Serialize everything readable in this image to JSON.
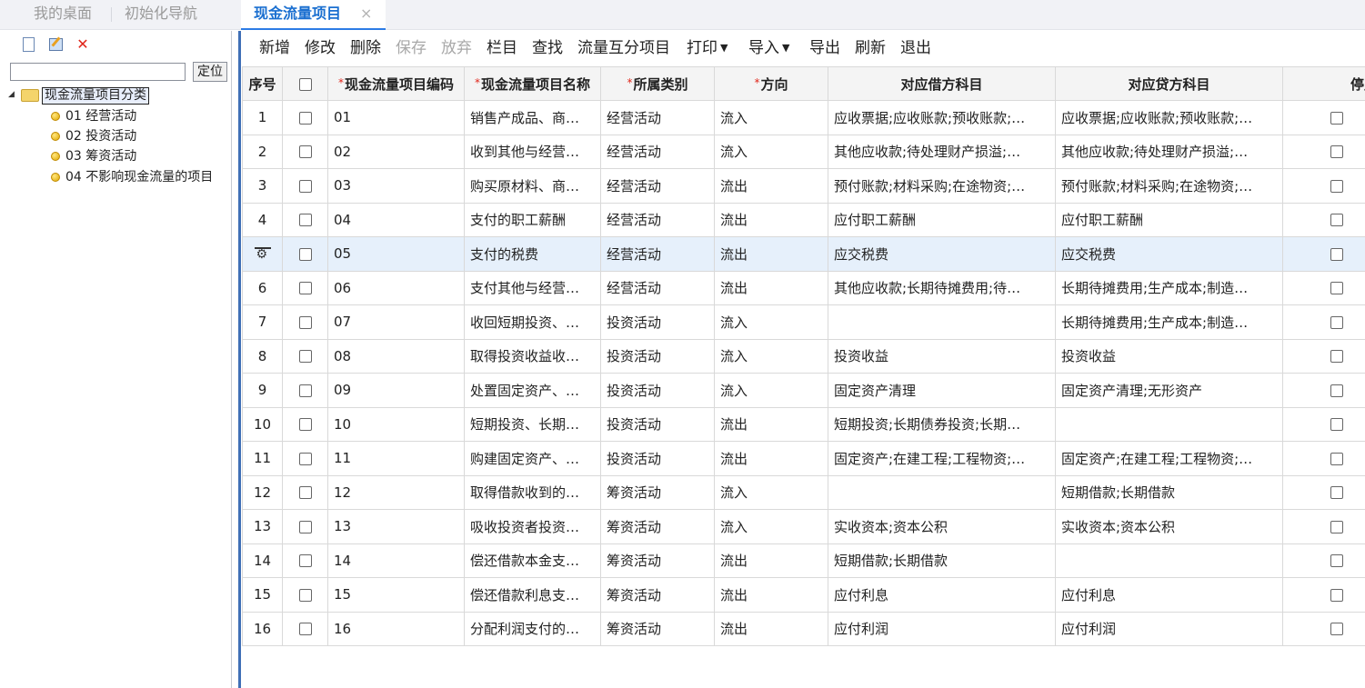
{
  "tabs": {
    "desktop": "我的桌面",
    "init_nav": "初始化导航",
    "active": "现金流量项目",
    "close": "×"
  },
  "left_panel": {
    "locate_button": "定位",
    "search_value": "",
    "tree": {
      "root": "现金流量项目分类",
      "children": [
        "01 经营活动",
        "02 投资活动",
        "03 筹资活动",
        "04 不影响现金流量的项目"
      ]
    }
  },
  "toolbar": {
    "add": "新增",
    "modify": "修改",
    "delete": "删除",
    "save": "保存",
    "discard": "放弃",
    "columns": "栏目",
    "find": "查找",
    "mutual": "流量互分项目",
    "print": "打印",
    "import": "导入",
    "export": "导出",
    "refresh": "刷新",
    "exit": "退出"
  },
  "grid": {
    "headers": {
      "seq": "序号",
      "code": "现金流量项目编码",
      "name": "现金流量项目名称",
      "category": "所属类别",
      "direction": "方向",
      "debit": "对应借方科目",
      "credit": "对应贷方科目",
      "disabled": "停用"
    },
    "rows": [
      {
        "seq": "1",
        "code": "01",
        "name": "销售产成品、商…",
        "category": "经营活动",
        "direction": "流入",
        "debit": "应收票据;应收账款;预收账款;…",
        "credit": "应收票据;应收账款;预收账款;…"
      },
      {
        "seq": "2",
        "code": "02",
        "name": "收到其他与经营…",
        "category": "经营活动",
        "direction": "流入",
        "debit": "其他应收款;待处理财产损溢;…",
        "credit": "其他应收款;待处理财产损溢;…"
      },
      {
        "seq": "3",
        "code": "03",
        "name": "购买原材料、商…",
        "category": "经营活动",
        "direction": "流出",
        "debit": "预付账款;材料采购;在途物资;…",
        "credit": "预付账款;材料采购;在途物资;…"
      },
      {
        "seq": "4",
        "code": "04",
        "name": "支付的职工薪酬",
        "category": "经营活动",
        "direction": "流出",
        "debit": "应付职工薪酬",
        "credit": "应付职工薪酬"
      },
      {
        "seq": "",
        "code": "05",
        "name": "支付的税费",
        "category": "经营活动",
        "direction": "流出",
        "debit": "应交税费",
        "credit": "应交税费"
      },
      {
        "seq": "6",
        "code": "06",
        "name": "支付其他与经营…",
        "category": "经营活动",
        "direction": "流出",
        "debit": "其他应收款;长期待摊费用;待…",
        "credit": "长期待摊费用;生产成本;制造…"
      },
      {
        "seq": "7",
        "code": "07",
        "name": "收回短期投资、…",
        "category": "投资活动",
        "direction": "流入",
        "debit": "",
        "credit": "长期待摊费用;生产成本;制造…"
      },
      {
        "seq": "8",
        "code": "08",
        "name": "取得投资收益收…",
        "category": "投资活动",
        "direction": "流入",
        "debit": "投资收益",
        "credit": "投资收益"
      },
      {
        "seq": "9",
        "code": "09",
        "name": "处置固定资产、…",
        "category": "投资活动",
        "direction": "流入",
        "debit": "固定资产清理",
        "credit": "固定资产清理;无形资产"
      },
      {
        "seq": "10",
        "code": "10",
        "name": "短期投资、长期…",
        "category": "投资活动",
        "direction": "流出",
        "debit": "短期投资;长期债券投资;长期…",
        "credit": ""
      },
      {
        "seq": "11",
        "code": "11",
        "name": "购建固定资产、…",
        "category": "投资活动",
        "direction": "流出",
        "debit": "固定资产;在建工程;工程物资;…",
        "credit": "固定资产;在建工程;工程物资;…"
      },
      {
        "seq": "12",
        "code": "12",
        "name": "取得借款收到的…",
        "category": "筹资活动",
        "direction": "流入",
        "debit": "",
        "credit": "短期借款;长期借款"
      },
      {
        "seq": "13",
        "code": "13",
        "name": "吸收投资者投资…",
        "category": "筹资活动",
        "direction": "流入",
        "debit": "实收资本;资本公积",
        "credit": "实收资本;资本公积"
      },
      {
        "seq": "14",
        "code": "14",
        "name": "偿还借款本金支…",
        "category": "筹资活动",
        "direction": "流出",
        "debit": "短期借款;长期借款",
        "credit": ""
      },
      {
        "seq": "15",
        "code": "15",
        "name": "偿还借款利息支…",
        "category": "筹资活动",
        "direction": "流出",
        "debit": "应付利息",
        "credit": "应付利息"
      },
      {
        "seq": "16",
        "code": "16",
        "name": "分配利润支付的…",
        "category": "筹资活动",
        "direction": "流出",
        "debit": "应付利润",
        "credit": "应付利润"
      }
    ]
  }
}
